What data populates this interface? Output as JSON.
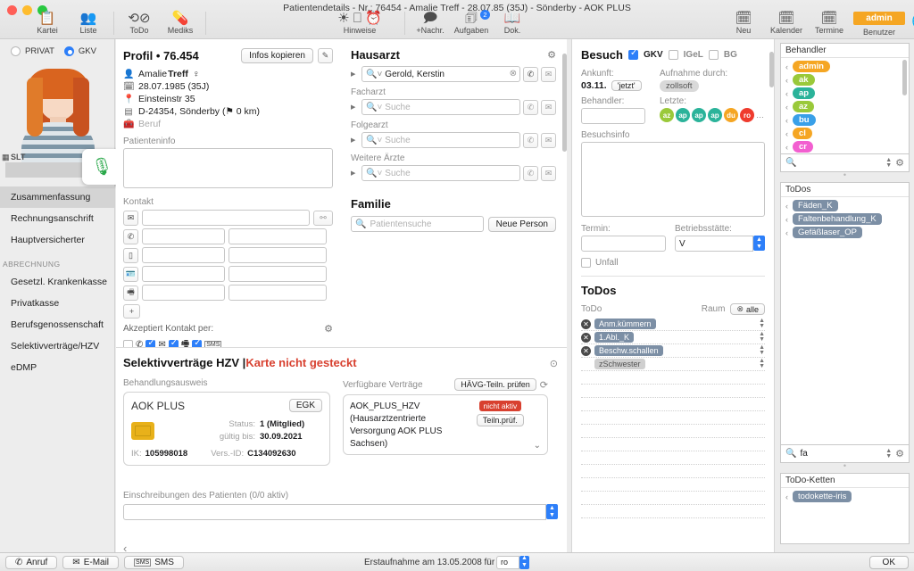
{
  "window": {
    "title": "Patientendetails - Nr.: 76454 - Amalie Treff - 28.07.85 (35J) - Sönderby - AOK PLUS"
  },
  "toolbar": {
    "left": [
      {
        "label": "Kartei",
        "icon": "clipboard-icon"
      },
      {
        "label": "Liste",
        "icon": "person-add-icon"
      },
      {
        "label": "ToDo",
        "icon": "check-circle-icon"
      },
      {
        "label": "Mediks",
        "icon": "pill-icon"
      }
    ],
    "middle": [
      {
        "label": "Hinweise",
        "icon": "lightbulb-icon"
      },
      {
        "label": "+Nachr.",
        "icon": "speech-bubble-icon"
      },
      {
        "label": "Aufgaben",
        "icon": "tasks-icon",
        "badge": "2"
      },
      {
        "label": "Dok.",
        "icon": "book-icon"
      }
    ],
    "right": [
      {
        "label": "Neu",
        "icon": "calendar-plus-icon"
      },
      {
        "label": "Kalender",
        "icon": "calendar-icon",
        "day": "31"
      },
      {
        "label": "Termine",
        "icon": "calendar-small-icon",
        "day": "31"
      }
    ],
    "user": {
      "name": "admin",
      "label": "Benutzer",
      "color": "#f5a623"
    },
    "globe_icon": "globe-check-icon"
  },
  "sidebar": {
    "insurance_options": [
      {
        "label": "PRIVAT",
        "selected": false
      },
      {
        "label": "GKV",
        "selected": true
      }
    ],
    "avatar_tag": "SLT",
    "mic_icon": "microphone-check-icon",
    "items": [
      {
        "label": "Zusammenfassung",
        "selected": true
      },
      {
        "label": "Rechnungsanschrift",
        "selected": false
      },
      {
        "label": "Hauptversicherter",
        "selected": false
      }
    ],
    "section_header": "ABRECHNUNG",
    "billing_items": [
      {
        "label": "Gesetzl. Krankenkasse"
      },
      {
        "label": "Privatkasse"
      },
      {
        "label": "Berufsgenossenschaft"
      },
      {
        "label": "Selektivverträge/HZV"
      },
      {
        "label": "eDMP"
      }
    ]
  },
  "profile": {
    "title": "Profil • 76.454",
    "copy_button": "Infos kopieren",
    "edit_icon": "pencil-icon",
    "name": "Amalie Treff",
    "name_first": "Amalie ",
    "name_last": "Treff",
    "gender_icon": "female-icon",
    "birthdate": "28.07.1985 (35J)",
    "street": "Einsteinstr 35",
    "city": "D-24354, Sönderby (⚑ 0 km)",
    "job": "Beruf",
    "info_label": "Patienteninfo",
    "info_value": "",
    "contact_label": "Kontakt",
    "email_value": "",
    "contact_rows": [
      {
        "icon": "phone-icon",
        "left": "",
        "right": ""
      },
      {
        "icon": "mobile-icon",
        "left": "",
        "right": ""
      },
      {
        "icon": "id-card-icon",
        "left": "",
        "right": ""
      },
      {
        "icon": "fax-icon",
        "left": "",
        "right": ""
      }
    ],
    "add_button": "+",
    "accept_label": "Akzeptiert Kontakt per:",
    "accept_options": [
      {
        "icon": "empty-box",
        "checked": false,
        "glyph": ""
      },
      {
        "icon": "phone-icon",
        "checked": false,
        "glyph": "✆"
      },
      {
        "icon": "email-icon",
        "checked": true,
        "glyph": "✉"
      },
      {
        "icon": "fax-icon",
        "checked": true,
        "glyph": "🖷"
      },
      {
        "icon": "sms-icon",
        "checked": true,
        "glyph": "SMS"
      }
    ],
    "gear_icon": "gear-icon"
  },
  "doctors": {
    "title": "Hausarzt",
    "gear_icon": "gear-icon",
    "rows": [
      {
        "label": "",
        "value": "Gerold, Kerstin",
        "placeholder": "Suche",
        "clearable": true
      },
      {
        "label": "Facharzt",
        "value": "",
        "placeholder": "Suche",
        "clearable": false
      },
      {
        "label": "Folgearzt",
        "value": "",
        "placeholder": "Suche",
        "clearable": false
      },
      {
        "label": "Weitere Ärzte",
        "value": "",
        "placeholder": "Suche",
        "clearable": false
      }
    ],
    "family_title": "Familie",
    "family_search_placeholder": "Patientensuche",
    "family_new_button": "Neue Person"
  },
  "visit": {
    "title": "Besuch",
    "types": [
      {
        "label": "GKV",
        "checked": true
      },
      {
        "label": "IGeL",
        "checked": false
      },
      {
        "label": "BG",
        "checked": false
      }
    ],
    "arrival_label": "Ankunft:",
    "arrival_value": "03.11.",
    "now_button": "'jetzt'",
    "admission_label": "Aufnahme durch:",
    "admission_value": "zollsoft",
    "practitioner_label": "Behandler:",
    "practitioner_value": "",
    "last_label": "Letzte:",
    "last_values": [
      {
        "code": "az",
        "color": "#9ac93a"
      },
      {
        "code": "ap",
        "color": "#2bb39a"
      },
      {
        "code": "ap",
        "color": "#2bb39a"
      },
      {
        "code": "ap",
        "color": "#2bb39a"
      },
      {
        "code": "du",
        "color": "#f5a623"
      },
      {
        "code": "ro",
        "color": "#ef3b2d"
      }
    ],
    "last_more": "…",
    "info_label": "Besuchsinfo",
    "info_value": "",
    "appointment_label": "Termin:",
    "appointment_value": "",
    "site_label": "Betriebsstätte:",
    "site_value": "V",
    "accident_label": "Unfall",
    "accident_checked": false,
    "todos_title": "ToDos",
    "todo_col": "ToDo",
    "room_col": "Raum",
    "all_button": "alle",
    "todos": [
      {
        "label": "Anm.kümmern",
        "removable": true,
        "active": true
      },
      {
        "label": "1.Abl._K",
        "removable": true,
        "active": true
      },
      {
        "label": "Beschw.schallen",
        "removable": true,
        "active": true
      },
      {
        "label": "zSchwester",
        "removable": false,
        "active": false
      }
    ]
  },
  "hzv": {
    "title_main": "Selektivverträge HZV | ",
    "title_warn": "Karte nicht gesteckt",
    "help_icon": "question-icon",
    "cert_label": "Behandlungsausweis",
    "card": {
      "insurer": "AOK PLUS",
      "type_button": "EGK",
      "chip_icon": "smartcard-chip-icon",
      "status_label": "Status:",
      "status_value": "1 (Mitglied)",
      "valid_label": "gültig bis:",
      "valid_value": "30.09.2021",
      "ik_label": "IK:",
      "ik_value": "105998018",
      "vers_label": "Vers.-ID:",
      "vers_value": "C134092630"
    },
    "contracts_label": "Verfügbare Verträge",
    "check_button": "HÄVG-Teiln. prüfen",
    "refresh_icon": "refresh-icon",
    "contract": {
      "name": "AOK_PLUS_HZV (Hausarztzentrierte Versorgung AOK PLUS Sachsen)",
      "status": "nicht aktiv",
      "check_button": "Teiln.prüf.",
      "expand_icon": "chevron-down-icon"
    },
    "enrollments_label": "Einschreibungen des Patienten (0/0 aktiv)",
    "enrollments_value": "",
    "collapse_icon": "chevron-left-icon"
  },
  "right_panel": {
    "practitioners_title": "Behandler",
    "practitioners": [
      {
        "code": "admin",
        "color": "#f5a623"
      },
      {
        "code": "ak",
        "color": "#9ac93a"
      },
      {
        "code": "ap",
        "color": "#2bb39a"
      },
      {
        "code": "az",
        "color": "#9ac93a"
      },
      {
        "code": "bu",
        "color": "#3aa0e8"
      },
      {
        "code": "cl",
        "color": "#f5a623"
      },
      {
        "code": "cr",
        "color": "#f25fd0"
      }
    ],
    "practitioners_search": "",
    "todos_title": "ToDos",
    "todos": [
      {
        "label": "Fäden_K"
      },
      {
        "label": "Faltenbehandlung_K"
      },
      {
        "label": "Gefäßlaser_OP"
      }
    ],
    "todos_search": "fa",
    "chains_title": "ToDo-Ketten",
    "chains": [
      {
        "label": "todokette-iris"
      }
    ],
    "search_icon": "search-icon",
    "gear_icon": "gear-icon"
  },
  "bottom": {
    "buttons": [
      {
        "label": "Anruf",
        "icon": "phone-icon"
      },
      {
        "label": "E-Mail",
        "icon": "email-icon"
      },
      {
        "label": "SMS",
        "icon": "sms-icon"
      }
    ],
    "status_text": "Erstaufnahme am 13.05.2008 für",
    "status_user": "ro",
    "ok_button": "OK"
  }
}
